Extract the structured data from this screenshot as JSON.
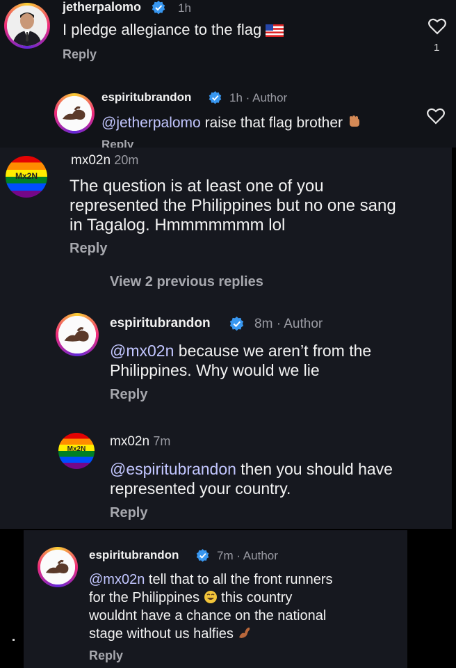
{
  "colors": {
    "background": "#16181f",
    "verified": "#3897f0",
    "mention": "#c2c6ff",
    "muted": "#9a9ba3"
  },
  "thread1": {
    "comment": {
      "username": "jetherpalomo",
      "time": "1h",
      "text": "I pledge allegiance to the flag",
      "emoji": "us-flag",
      "reply": "Reply",
      "like_count": "1"
    },
    "reply": {
      "username": "espiritubrandon",
      "time": "1h",
      "author": "· Author",
      "mention": "@jetherpalomo",
      "text": " raise that flag brother",
      "emoji": "raised-fist",
      "reply": "Reply"
    }
  },
  "thread2": {
    "comment": {
      "username": "mx02n",
      "time": "20m",
      "avatar_text": "Mx2N",
      "text_line1": "The question is at least one of you",
      "text_line2": "represented the Philippines but no one sang",
      "text_line3": "in Tagalog. Hmmmmmmm lol",
      "reply": "Reply"
    },
    "view_previous": "View 2 previous replies",
    "reply1": {
      "username": "espiritubrandon",
      "time": "8m",
      "author": "· Author",
      "mention": "@mx02n",
      "text_line1": " because we aren’t from the",
      "text_line2": "Philippines. Why would we lie",
      "reply": "Reply"
    },
    "reply2": {
      "username": "mx02n",
      "time": "7m",
      "avatar_text": "Mx2N",
      "mention": "@espiritubrandon",
      "text_line1": " then you should have",
      "text_line2": "represented your country.",
      "reply": "Reply"
    }
  },
  "thread3": {
    "reply": {
      "username": "espiritubrandon",
      "time": "7m",
      "author": "· Author",
      "mention": "@mx02n",
      "text_line1": " tell that to all the front runners",
      "text_line2": "for the Philippines",
      "emoji1": "grinning-sweat",
      "text_line2b": " this country",
      "text_line3": "wouldnt have a chance on the national",
      "text_line4": "stage without us halfies",
      "emoji2": "flexed-biceps",
      "reply": "Reply"
    }
  }
}
